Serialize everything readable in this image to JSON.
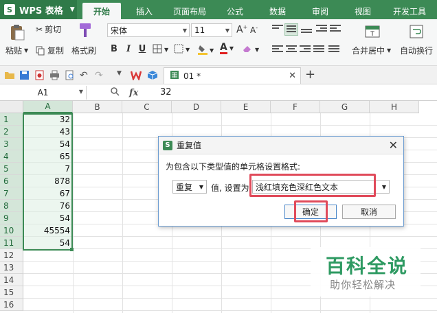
{
  "app": {
    "name": "WPS 表格",
    "logo_text": "S"
  },
  "ribbon_tabs": [
    {
      "label": "开始",
      "active": true
    },
    {
      "label": "插入",
      "active": false
    },
    {
      "label": "页面布局",
      "active": false
    },
    {
      "label": "公式",
      "active": false
    },
    {
      "label": "数据",
      "active": false
    },
    {
      "label": "审阅",
      "active": false
    },
    {
      "label": "视图",
      "active": false
    },
    {
      "label": "开发工具",
      "active": false
    }
  ],
  "ribbon": {
    "cut": "剪切",
    "paste": "粘贴",
    "copy": "复制",
    "format_painter": "格式刷",
    "font_name": "宋体",
    "font_size": "11",
    "bold": "B",
    "italic": "I",
    "underline": "U",
    "merge_center": "合并居中",
    "wrap_text": "自动换行"
  },
  "document_tab": {
    "name": "01 *"
  },
  "formula_bar": {
    "cell_ref": "A1",
    "value": "32"
  },
  "columns": [
    "A",
    "B",
    "C",
    "D",
    "E",
    "F",
    "G",
    "H"
  ],
  "rows": [
    "1",
    "2",
    "3",
    "4",
    "5",
    "6",
    "7",
    "8",
    "9",
    "10",
    "11",
    "12",
    "13",
    "14",
    "15",
    "16"
  ],
  "column_a_values": [
    "32",
    "43",
    "54",
    "65",
    "7",
    "878",
    "67",
    "76",
    "54",
    "45554",
    "54"
  ],
  "dialog": {
    "title": "重复值",
    "prompt": "为包含以下类型值的单元格设置格式:",
    "type_value": "重复",
    "middle_label": "值, 设置为",
    "format_value": "浅红填充色深红色文本",
    "ok": "确定",
    "cancel": "取消"
  },
  "watermark": {
    "title": "百科全说",
    "subtitle": "助你轻松解决"
  },
  "colors": {
    "accent": "#3c8a55",
    "highlight": "#e04a5a"
  }
}
